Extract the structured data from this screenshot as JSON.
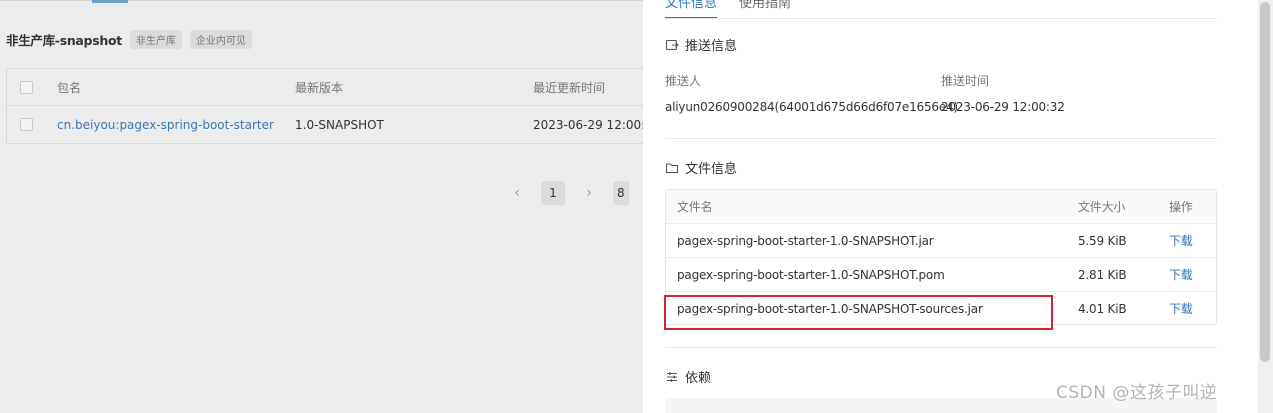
{
  "background_page": {
    "repo_title": "非生产库-snapshot",
    "tags": [
      "非生产库",
      "企业内可见"
    ],
    "table": {
      "headers": [
        "包名",
        "最新版本",
        "最近更新时间"
      ],
      "rows": [
        {
          "package": "cn.beiyou:pagex-spring-boot-starter",
          "version": "1.0-SNAPSHOT",
          "updated": "2023-06-29 12:00:34"
        }
      ]
    },
    "pagination": {
      "prev": "‹",
      "current_page": "1",
      "next": "›",
      "page_size_partial": "8"
    }
  },
  "drawer": {
    "tabs": [
      {
        "label": "文件信息",
        "active": true
      },
      {
        "label": "使用指南",
        "active": false
      }
    ],
    "push_section": {
      "title": "推送信息",
      "pusher_label": "推送人",
      "pusher_value": "aliyun0260900284(64001d675d66d6f07e1656e4)",
      "time_label": "推送时间",
      "time_value": "2023-06-29 12:00:32"
    },
    "file_section": {
      "title": "文件信息",
      "headers": {
        "name": "文件名",
        "size": "文件大小",
        "op": "操作"
      },
      "files": [
        {
          "name": "pagex-spring-boot-starter-1.0-SNAPSHOT.jar",
          "size": "5.59 KiB",
          "op": "下载"
        },
        {
          "name": "pagex-spring-boot-starter-1.0-SNAPSHOT.pom",
          "size": "2.81 KiB",
          "op": "下载"
        },
        {
          "name": "pagex-spring-boot-starter-1.0-SNAPSHOT-sources.jar",
          "size": "4.01 KiB",
          "op": "下载"
        }
      ]
    },
    "deps_section": {
      "title": "依赖"
    }
  },
  "watermark": "CSDN @这孩子叫逆",
  "colors": {
    "accent": "#2f74c0",
    "highlight": "#d9232c"
  }
}
